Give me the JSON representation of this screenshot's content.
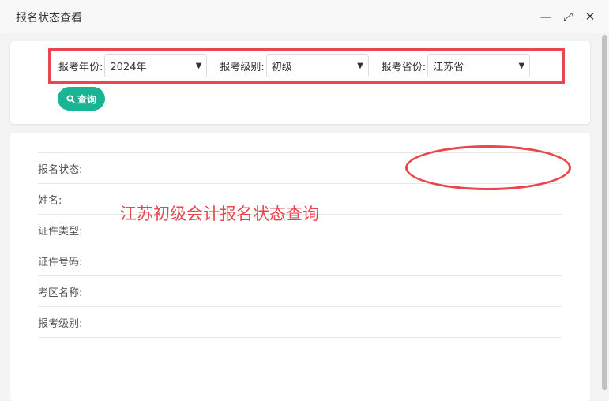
{
  "window": {
    "title": "报名状态查看",
    "minimize": "—",
    "maximize": "⤢",
    "close": "✕"
  },
  "filters": [
    {
      "label": "报考年份:",
      "value": "2024年"
    },
    {
      "label": "报考级别:",
      "value": "初级"
    },
    {
      "label": "报考省份:",
      "value": "江苏省"
    }
  ],
  "query_button": "查询",
  "fields": [
    "报名状态:",
    "姓名:",
    "证件类型:",
    "证件号码:",
    "考区名称:",
    "报考级别:"
  ],
  "overlay_text": "江苏初级会计报名状态查询",
  "colors": {
    "accent": "#1ab394",
    "annotation": "#e8474d"
  }
}
